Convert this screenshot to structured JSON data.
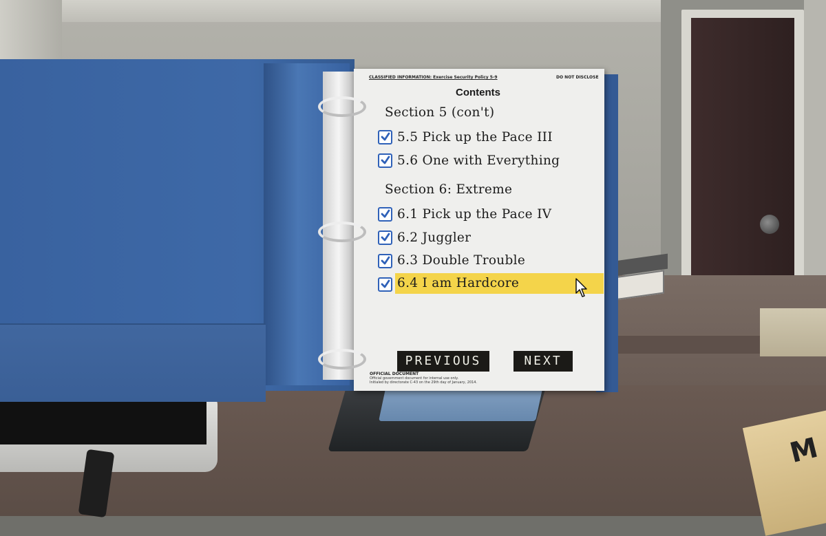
{
  "page": {
    "header_left": "CLASSIFIED INFORMATION: Exercise Security Policy 5-9",
    "header_right": "DO NOT DISCLOSE",
    "title": "Contents"
  },
  "sections": [
    {
      "heading": "Section 5 (con't)",
      "items": [
        {
          "label": "5.5 Pick up the Pace III",
          "checked": true
        },
        {
          "label": "5.6 One with Everything",
          "checked": true
        }
      ]
    },
    {
      "heading": "Section 6: Extreme",
      "items": [
        {
          "label": "6.1 Pick up the Pace IV",
          "checked": true
        },
        {
          "label": "6.2 Juggler",
          "checked": true
        },
        {
          "label": "6.3 Double Trouble",
          "checked": true
        },
        {
          "label": "6.4 I am Hardcore",
          "checked": true,
          "highlighted": true
        }
      ]
    }
  ],
  "buttons": {
    "previous": "PREVIOUS",
    "next": "NEXT"
  },
  "footer": {
    "title": "OFFICIAL DOCUMENT",
    "line1": "Official government document for internal use only.",
    "line2": "Initialed by directorate C-43 on the 29th day of January, 2014."
  },
  "background": {
    "folder_letter": "M"
  },
  "colors": {
    "highlight": "#f4d44a",
    "checkbox": "#2f61b8",
    "binder": "#3e69a7",
    "button_bg": "#1b1a17"
  }
}
